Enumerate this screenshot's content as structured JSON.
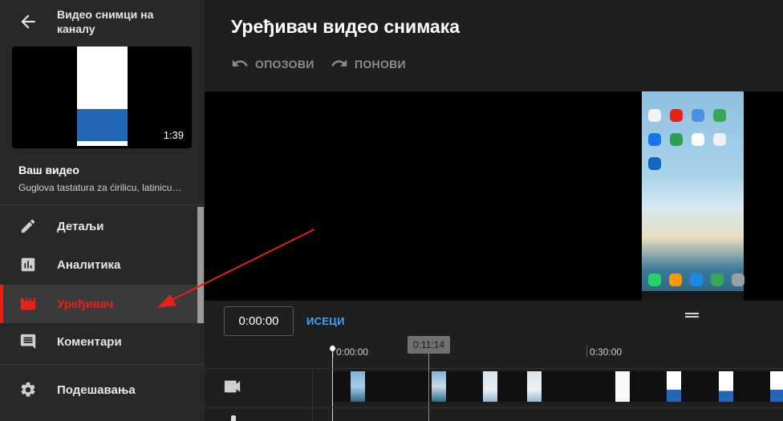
{
  "sidebar": {
    "channel_title": "Видео снимци на каналу",
    "thumbnail_duration": "1:39",
    "your_video_label": "Ваш видео",
    "video_name": "Guglova tastatura za ćirilicu, latinicu…",
    "items": [
      {
        "label": "Детаљи",
        "icon": "pencil-icon"
      },
      {
        "label": "Аналитика",
        "icon": "analytics-icon"
      },
      {
        "label": "Уређивач",
        "icon": "film-icon",
        "active": true
      },
      {
        "label": "Коментари",
        "icon": "comment-icon"
      },
      {
        "label": "Подешавања",
        "icon": "gear-icon"
      }
    ]
  },
  "main": {
    "title": "Уређивач видео снимака",
    "undo_label": "ОПОЗОВИ",
    "redo_label": "ПОНОВИ",
    "current_time": "0:00:00",
    "trim_label": "ИСЕЦИ",
    "ruler": [
      "0:00:00",
      "0:30:00"
    ],
    "playhead_time": "0:11:14"
  },
  "colors": {
    "accent_red": "#e62117",
    "link_blue": "#3ea6ff",
    "sidebar_bg": "#282828",
    "main_bg": "#1f1f1f"
  }
}
